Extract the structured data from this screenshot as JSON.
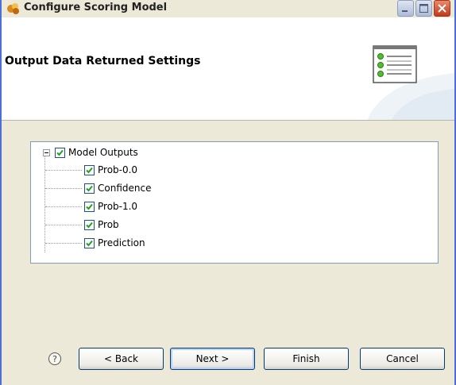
{
  "window": {
    "title": "Configure Scoring Model"
  },
  "header": {
    "title": "Output Data Returned Settings"
  },
  "tree": {
    "root": {
      "label": "Model Outputs",
      "checked": true,
      "expanded": true
    },
    "children": [
      {
        "label": "Prob-0.0",
        "checked": true
      },
      {
        "label": "Confidence",
        "checked": true
      },
      {
        "label": "Prob-1.0",
        "checked": true
      },
      {
        "label": "Prob",
        "checked": true
      },
      {
        "label": "Prediction",
        "checked": true
      }
    ]
  },
  "footer": {
    "help_symbol": "?",
    "back_label": "< Back",
    "next_label": "Next >",
    "finish_label": "Finish",
    "cancel_label": "Cancel"
  },
  "colors": {
    "accent": "#4b6fd6",
    "check": "#21a121"
  },
  "icons": [
    "app-icon",
    "minimize-icon",
    "maximize-icon",
    "close-icon",
    "settings-list-icon",
    "help-icon",
    "collapse-icon",
    "checkbox-checked-icon"
  ]
}
